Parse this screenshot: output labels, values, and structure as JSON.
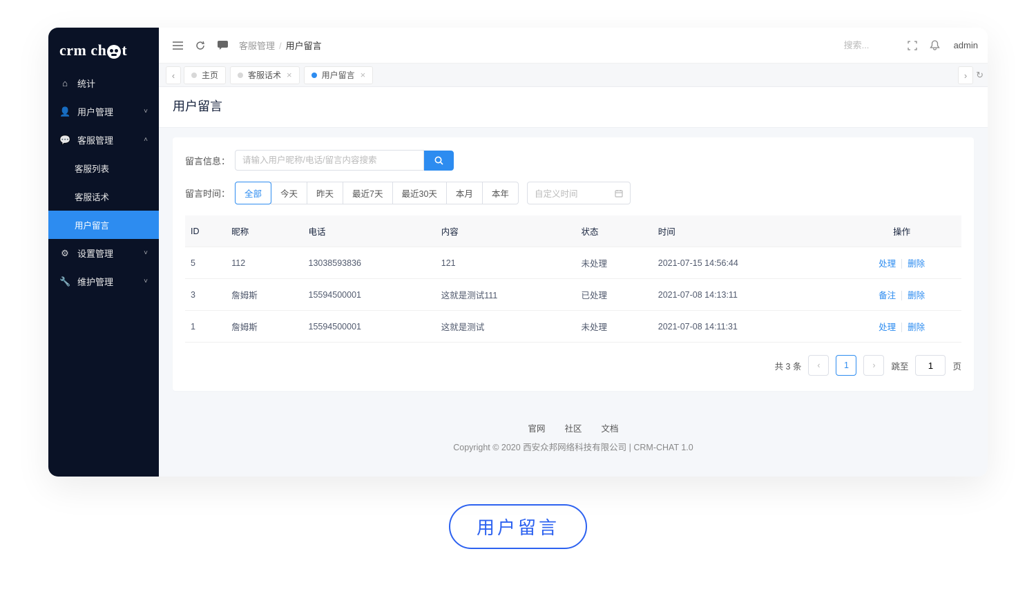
{
  "logo": {
    "left": "crm ch",
    "right": "t"
  },
  "sidebar": {
    "items": [
      {
        "label": "统计",
        "icon": "home-icon",
        "caret": ""
      },
      {
        "label": "用户管理",
        "icon": "user-icon",
        "caret": "down"
      },
      {
        "label": "客服管理",
        "icon": "chat-icon",
        "caret": "up"
      },
      {
        "label": "客服列表",
        "child": true
      },
      {
        "label": "客服话术",
        "child": true
      },
      {
        "label": "用户留言",
        "child": true,
        "active": true
      },
      {
        "label": "设置管理",
        "icon": "gear-icon",
        "caret": "down"
      },
      {
        "label": "维护管理",
        "icon": "wrench-icon",
        "caret": "down"
      }
    ]
  },
  "header": {
    "breadcrumb_parent": "客服管理",
    "breadcrumb_current": "用户留言",
    "search_placeholder": "搜索...",
    "user": "admin"
  },
  "tabs": [
    {
      "label": "主页",
      "closable": false
    },
    {
      "label": "客服话术",
      "closable": true
    },
    {
      "label": "用户留言",
      "closable": true,
      "active": true
    }
  ],
  "page": {
    "title": "用户留言",
    "filter_label": "留言信息：",
    "filter_placeholder": "请输入用户昵称/电话/留言内容搜索",
    "time_label": "留言时间：",
    "time_options": [
      "全部",
      "今天",
      "昨天",
      "最近7天",
      "最近30天",
      "本月",
      "本年"
    ],
    "time_selected": "全部",
    "date_placeholder": "自定义时间"
  },
  "table": {
    "headers": [
      "ID",
      "昵称",
      "电话",
      "内容",
      "状态",
      "时间",
      "操作"
    ],
    "rows": [
      {
        "id": "5",
        "nick": "112",
        "phone": "13038593836",
        "content": "121",
        "status": "未处理",
        "time": "2021-07-15 14:56:44",
        "actions": [
          "处理",
          "删除"
        ]
      },
      {
        "id": "3",
        "nick": "詹姆斯",
        "phone": "15594500001",
        "content": "这就是测试111",
        "status": "已处理",
        "time": "2021-07-08 14:13:11",
        "actions": [
          "备注",
          "删除"
        ]
      },
      {
        "id": "1",
        "nick": "詹姆斯",
        "phone": "15594500001",
        "content": "这就是测试",
        "status": "未处理",
        "time": "2021-07-08 14:11:31",
        "actions": [
          "处理",
          "删除"
        ]
      }
    ]
  },
  "pager": {
    "total_text": "共 3 条",
    "current": "1",
    "jump_pre": "跳至",
    "jump_val": "1",
    "jump_post": "页"
  },
  "footer": {
    "links": [
      "官网",
      "社区",
      "文档"
    ],
    "copy": "Copyright © 2020 西安众邦网络科技有限公司 | CRM-CHAT 1.0"
  },
  "badge": "用户留言"
}
